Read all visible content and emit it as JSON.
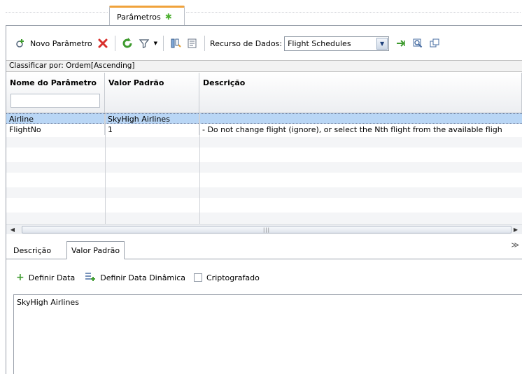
{
  "tabs": {
    "parameters_label": "Parâmetros"
  },
  "toolbar": {
    "new_param_label": "Novo Parâmetro",
    "data_resource_label": "Recurso de Dados:",
    "data_resource_value": "Flight Schedules"
  },
  "sortbar": {
    "text": "Classificar por: Ordem[Ascending]"
  },
  "grid": {
    "columns": [
      "Nome do Parâmetro",
      "Valor Padrão",
      "Descrição"
    ],
    "rows": [
      {
        "name": "Airline",
        "value": "SkyHigh Airlines",
        "description": ""
      },
      {
        "name": "FlightNo",
        "value": "1",
        "description": "- Do not change flight (ignore), or select the Nth flight from the available fligh"
      }
    ]
  },
  "lower_tabs": {
    "description_label": "Descrição",
    "default_value_label": "Valor Padrão"
  },
  "default_value_toolbar": {
    "set_data_label": "Definir Data",
    "set_dynamic_data_label": "Definir Data Dinâmica",
    "encrypted_label": "Criptografado"
  },
  "default_value_text": "SkyHigh Airlines",
  "colors": {
    "accent_tab": "#f0a23b",
    "selected_row": "#b9d6f5",
    "delete": "#d9302c",
    "refresh": "#3f9b2f"
  }
}
